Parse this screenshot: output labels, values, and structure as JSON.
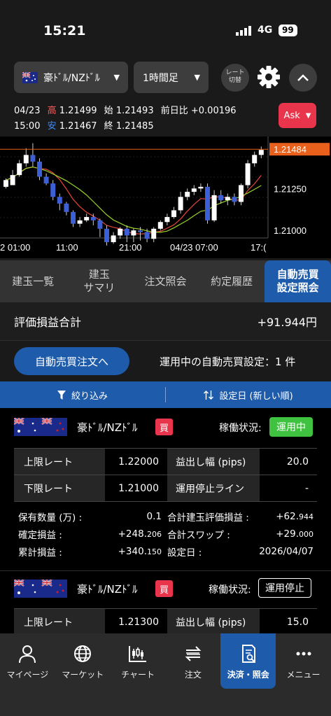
{
  "status": {
    "time": "15:21",
    "network": "4G",
    "battery": "99"
  },
  "toolbar": {
    "pair": "豪ﾄﾞﾙ/NZﾄﾞﾙ",
    "timeframe": "1時間足",
    "rate_switch_line1": "レート",
    "rate_switch_line2": "切替"
  },
  "ohlc": {
    "date": "04/23",
    "high_label": "高",
    "high": "1.21499",
    "open_label": "始",
    "open": "1.21493",
    "change_label": "前日比",
    "change": "+0.00196",
    "time": "15:00",
    "low_label": "安",
    "low": "1.21467",
    "close_label": "終",
    "close": "1.21485"
  },
  "ask_button": "Ask",
  "chart_data": {
    "type": "candlestick",
    "current_price": "1.21484",
    "y_ticks": [
      "1.21250",
      "1.21000"
    ],
    "x_ticks": [
      "2 01:00",
      "11:00",
      "21:00",
      "04/23 07:00",
      "17:("
    ],
    "price_line_color": "#e8601c",
    "up_color": "#ffffff",
    "down_color": "#3d5fd6",
    "ma_colors": [
      "#e8453c",
      "#9bd12a"
    ],
    "candles": [
      [
        1.2126,
        1.213,
        1.2125,
        1.2131
      ],
      [
        1.2127,
        1.2133,
        1.2127,
        1.2136
      ],
      [
        1.2133,
        1.214,
        1.2132,
        1.2142
      ],
      [
        1.214,
        1.2145,
        1.2138,
        1.2149
      ],
      [
        1.2145,
        1.2141,
        1.2138,
        1.2152
      ],
      [
        1.2141,
        1.2132,
        1.213,
        1.2143
      ],
      [
        1.2132,
        1.2128,
        1.2127,
        1.2134
      ],
      [
        1.2128,
        1.212,
        1.2118,
        1.213
      ],
      [
        1.212,
        1.2116,
        1.2112,
        1.2122
      ],
      [
        1.2116,
        1.2111,
        1.2109,
        1.2117
      ],
      [
        1.2111,
        1.2104,
        1.2102,
        1.2112
      ],
      [
        1.2104,
        1.2106,
        1.2102,
        1.2108
      ],
      [
        1.2106,
        1.2108,
        1.2105,
        1.211
      ],
      [
        1.2108,
        1.2106,
        1.2103,
        1.211
      ],
      [
        1.2106,
        1.2101,
        1.2096,
        1.2107
      ],
      [
        1.2101,
        1.2093,
        1.2091,
        1.2103
      ],
      [
        1.2093,
        1.2097,
        1.2092,
        1.2099
      ],
      [
        1.2097,
        1.2101,
        1.2095,
        1.2102
      ],
      [
        1.2101,
        1.2097,
        1.2093,
        1.2103
      ],
      [
        1.2097,
        1.21,
        1.2093,
        1.2101
      ],
      [
        1.21,
        1.2099,
        1.2094,
        1.2102
      ],
      [
        1.2099,
        1.2095,
        1.2093,
        1.2101
      ],
      [
        1.2095,
        1.2101,
        1.2093,
        1.2102
      ],
      [
        1.2101,
        1.2105,
        1.21,
        1.2106
      ],
      [
        1.2105,
        1.2108,
        1.2103,
        1.211
      ],
      [
        1.2108,
        1.2112,
        1.2107,
        1.2114
      ],
      [
        1.2112,
        1.212,
        1.211,
        1.2123
      ],
      [
        1.212,
        1.2123,
        1.2118,
        1.2125
      ],
      [
        1.2123,
        1.2125,
        1.2121,
        1.2127
      ],
      [
        1.2125,
        1.2126,
        1.2123,
        1.2128
      ],
      [
        1.2126,
        1.2106,
        1.2104,
        1.2128
      ],
      [
        1.2106,
        1.2121,
        1.2105,
        1.2124
      ],
      [
        1.2121,
        1.2118,
        1.2116,
        1.2124
      ],
      [
        1.2118,
        1.212,
        1.2115,
        1.2122
      ],
      [
        1.212,
        1.2117,
        1.2115,
        1.2122
      ],
      [
        1.2117,
        1.2127,
        1.2115,
        1.2128
      ],
      [
        1.2127,
        1.214,
        1.2125,
        1.2142
      ],
      [
        1.214,
        1.2145,
        1.2138,
        1.2147
      ],
      [
        1.2145,
        1.2148,
        1.2143,
        1.215
      ]
    ]
  },
  "tabs": [
    {
      "label": "建玉一覧"
    },
    {
      "label": "建玉\nサマリ"
    },
    {
      "label": "注文照会"
    },
    {
      "label": "約定履歴"
    },
    {
      "label": "自動売買\n設定照会"
    }
  ],
  "summary": {
    "label": "評価損益合計",
    "value": "+91.944円"
  },
  "order_button": "自動売買注文へ",
  "running_settings": "運用中の自動売買設定：1 件",
  "filter": {
    "filter_label": "絞り込み",
    "sort_label": "設定日 (新しい順)"
  },
  "cards": [
    {
      "pair": "豪ﾄﾞﾙ/NZﾄﾞﾙ",
      "side": "買",
      "status_label": "稼働状況:",
      "status": "運用中",
      "upper_rate_label": "上限レート",
      "upper_rate": "1.22000",
      "profit_width_label": "益出し幅 (pips)",
      "profit_width": "20.0",
      "lower_rate_label": "下限レート",
      "lower_rate": "1.21000",
      "stop_line_label": "運用停止ライン",
      "stop_line": "-",
      "qty_label": "保有数量 (万) :",
      "qty": "0.1",
      "total_eval_label": "合計建玉評価損益 :",
      "total_eval_main": "+62.",
      "total_eval_dec": "944",
      "realized_label": "確定損益 :",
      "realized_main": "+248.",
      "realized_dec": "206",
      "swap_label": "合計スワップ :",
      "swap_main": "+29.",
      "swap_dec": "000",
      "cum_label": "累計損益 :",
      "cum_main": "+340.",
      "cum_dec": "150",
      "date_label": "設定日 :",
      "date": "2026/04/07"
    },
    {
      "pair": "豪ﾄﾞﾙ/NZﾄﾞﾙ",
      "side": "買",
      "status_label": "稼働状況:",
      "status": "運用停止",
      "upper_rate_label": "上限レート",
      "upper_rate": "1.21300",
      "profit_width_label": "益出し幅 (pips)",
      "profit_width": "15.0"
    }
  ],
  "nav": [
    {
      "label": "マイページ",
      "icon": "person-icon"
    },
    {
      "label": "マーケット",
      "icon": "globe-icon"
    },
    {
      "label": "チャート",
      "icon": "candle-chart-icon"
    },
    {
      "label": "注文",
      "icon": "transfer-arrows-icon"
    },
    {
      "label": "決済・照会",
      "icon": "document-search-icon"
    },
    {
      "label": "メニュー",
      "icon": "more-icon"
    }
  ]
}
